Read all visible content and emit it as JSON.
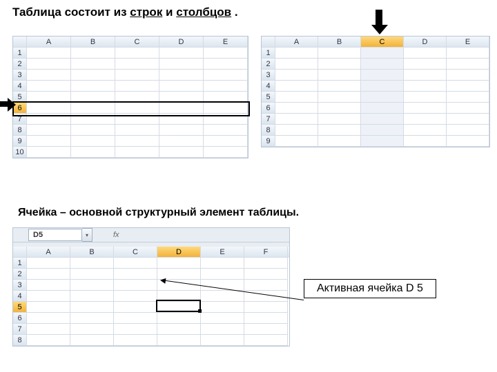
{
  "title_top": {
    "t1": "Таблица состоит из ",
    "t2": "строк",
    "t3": " и  ",
    "t4": "столбцов",
    "t5": " ."
  },
  "title_mid": "Ячейка – основной структурный элемент таблицы.",
  "sheet1": {
    "cols": [
      "A",
      "B",
      "C",
      "D",
      "E"
    ],
    "rows": [
      "1",
      "2",
      "3",
      "4",
      "5",
      "6",
      "7",
      "8",
      "9",
      "10"
    ],
    "selected_row": "6"
  },
  "sheet2": {
    "cols": [
      "A",
      "B",
      "C",
      "D",
      "E"
    ],
    "rows": [
      "1",
      "2",
      "3",
      "4",
      "5",
      "6",
      "7",
      "8",
      "9"
    ],
    "selected_col": "C"
  },
  "sheet3": {
    "namebox": "D5",
    "fx_label": "fx",
    "cols": [
      "A",
      "B",
      "C",
      "D",
      "E",
      "F"
    ],
    "rows": [
      "1",
      "2",
      "3",
      "4",
      "5",
      "6",
      "7",
      "8"
    ],
    "active": {
      "col": "D",
      "row": "5"
    }
  },
  "callout": "Активная ячейка D 5"
}
